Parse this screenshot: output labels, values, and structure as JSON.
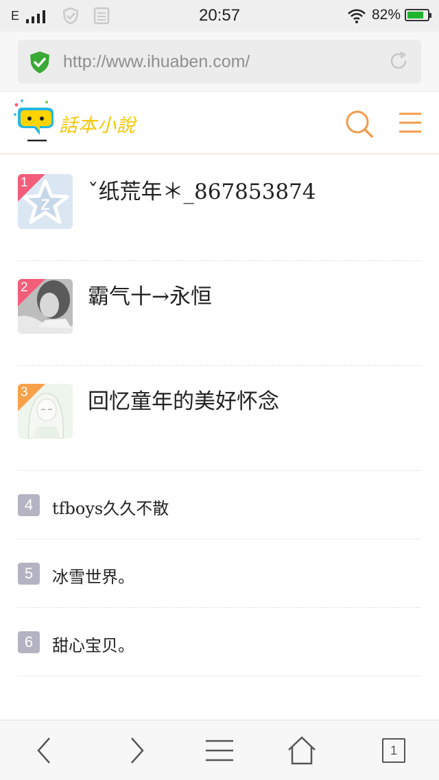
{
  "status_bar": {
    "network": "E",
    "time": "20:57",
    "battery_percent": "82%",
    "battery_level": 0.82
  },
  "browser": {
    "url": "http://www.ihuaben.com/"
  },
  "site": {
    "logo_text": "話本小說"
  },
  "ranking": [
    {
      "rank": "1",
      "name": "ˇ纸荒年＊_867853874",
      "badge_color": "#f25d7a"
    },
    {
      "rank": "2",
      "name": "霸气十→永恒",
      "badge_color": "#f25d7a"
    },
    {
      "rank": "3",
      "name": "回忆童年的美好怀念",
      "badge_color": "#f7a24a"
    },
    {
      "rank": "4",
      "name": "tfboys久久不散"
    },
    {
      "rank": "5",
      "name": "冰雪世界。"
    },
    {
      "rank": "6",
      "name": "甜心宝贝。"
    }
  ],
  "toolbar": {
    "tab_count": "1"
  },
  "colors": {
    "accent": "#f39a4b",
    "secure_green": "#3aa935",
    "battery_green": "#1fb52f",
    "logo_yellow": "#f5c600"
  }
}
